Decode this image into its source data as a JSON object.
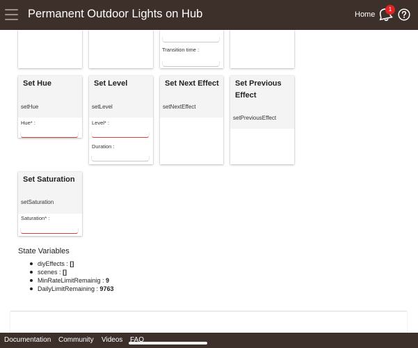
{
  "header": {
    "title": "Permanent Outdoor Lights on Hub",
    "home_label": "Home",
    "notification_count": "1"
  },
  "top_cards": [
    {
      "field_label": "Transition time :"
    }
  ],
  "commands": [
    {
      "title": "Set Hue",
      "command": "setHue",
      "fields": [
        "Hue* :"
      ]
    },
    {
      "title": "Set Level",
      "command": "setLevel",
      "fields": [
        "Level* :",
        "Duration :"
      ]
    },
    {
      "title": "Set Next Effect",
      "command": "setNextEffect",
      "fields": []
    },
    {
      "title_line1": "Set Previous",
      "title_line2": "Effect",
      "command": "setPreviousEffect",
      "fields": []
    },
    {
      "title": "Set Saturation",
      "command": "setSaturation",
      "fields": [
        "Saturation* :"
      ]
    }
  ],
  "state": {
    "title": "State Variables",
    "items": [
      {
        "name": "diyEffects : ",
        "value": "[]"
      },
      {
        "name": "scenes : ",
        "value": "[]"
      },
      {
        "name": "MinRateLimitRemainig : ",
        "value": "9"
      },
      {
        "name": "DailyLimitRemaining : ",
        "value": "9763"
      }
    ]
  },
  "footer": {
    "links": [
      "Documentation",
      "Community",
      "Videos",
      "FAQ"
    ]
  },
  "colors": {
    "header_bg": "#3d2f2a",
    "badge": "#e02424",
    "required_underline": "#d04040"
  }
}
